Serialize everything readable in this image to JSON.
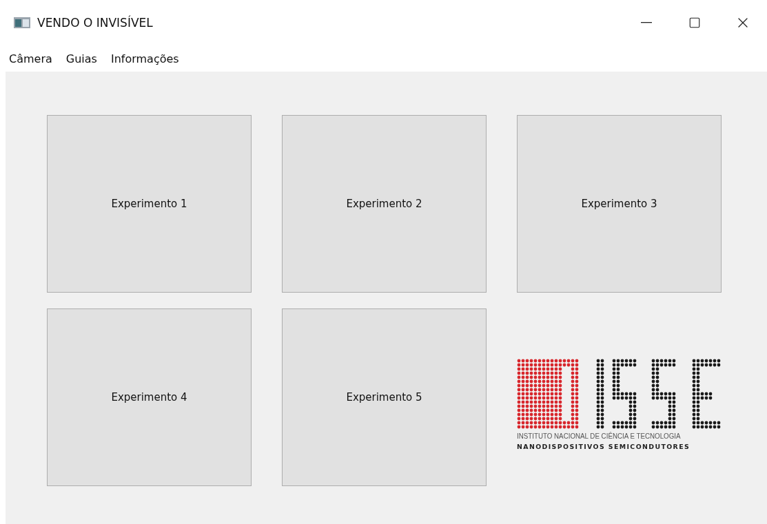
{
  "window": {
    "title": "VENDO O INVISÍVEL"
  },
  "menu": [
    {
      "label": "Câmera"
    },
    {
      "label": "Guias"
    },
    {
      "label": "Informações"
    }
  ],
  "buttons": [
    {
      "label": "Experimento 1"
    },
    {
      "label": "Experimento 2"
    },
    {
      "label": "Experimento 3"
    },
    {
      "label": "Experimento 4"
    },
    {
      "label": "Experimento 5"
    }
  ],
  "logo": {
    "line_1": "INSTITUTO NACIONAL DE CIÊNCIA E TECNOLOGIA",
    "line_2": "NANODISPOSITIVOS SEMICONDUTORES"
  }
}
